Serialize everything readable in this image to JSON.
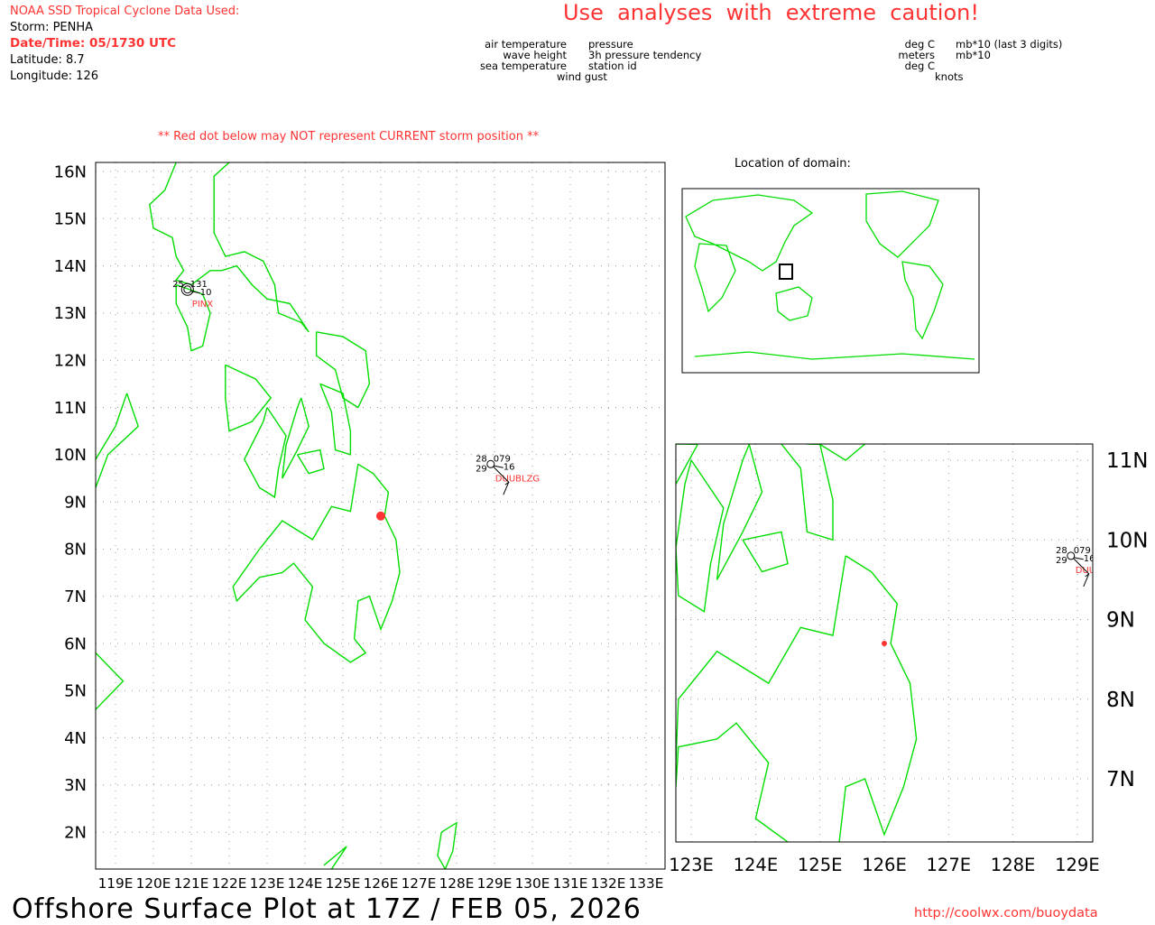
{
  "header": {
    "source": "NOAA SSD Tropical Cyclone Data Used:",
    "storm": "Storm: PENHA",
    "datetime": "Date/Time: 05/1730 UTC",
    "latitude": "Latitude: 8.7",
    "longitude": "Longitude: 126",
    "caution": "Use  analyses  with  extreme  caution!",
    "red_dot_note": "** Red dot below may NOT represent CURRENT storm position **"
  },
  "legend": {
    "left": {
      "air_temp": "air temperature",
      "wave": "wave height",
      "sea_temp": "sea temperature",
      "pressure": "pressure",
      "tendency": "3h pressure tendency",
      "station": "station id",
      "gust": "wind gust"
    },
    "right": {
      "air_temp": "deg C",
      "wave": "meters",
      "sea_temp": "deg C",
      "pressure": "mb*10 (last 3 digits)",
      "tendency": "mb*10",
      "gust": "knots"
    }
  },
  "main_map": {
    "lat_labels": [
      "16N",
      "15N",
      "14N",
      "13N",
      "12N",
      "11N",
      "10N",
      "9N",
      "8N",
      "7N",
      "6N",
      "5N",
      "4N",
      "3N",
      "2N"
    ],
    "lon_labels": [
      "119E",
      "120E",
      "121E",
      "122E",
      "123E",
      "124E",
      "125E",
      "126E",
      "127E",
      "128E",
      "129E",
      "130E",
      "131E",
      "132E",
      "133E"
    ]
  },
  "inset_map": {
    "lat_labels": [
      "11N",
      "10N",
      "9N",
      "8N",
      "7N"
    ],
    "lon_labels": [
      "123E",
      "124E",
      "125E",
      "126E",
      "127E",
      "128E",
      "129E"
    ]
  },
  "domain_map": {
    "title": "Location of domain:"
  },
  "stations": [
    {
      "id": "PINX",
      "air_temp": "25",
      "pressure": "131",
      "tendency": "10",
      "lat": 13.5,
      "lon": 120.9
    },
    {
      "id": "DUUBLZG",
      "air_temp": "28",
      "sea_temp": "29",
      "pressure": "079",
      "tendency": "16",
      "lat": 9.8,
      "lon": 128.9
    }
  ],
  "storm_position": {
    "lat": 8.7,
    "lon": 126,
    "color": "#ff3333"
  },
  "footer": {
    "title": "Offshore Surface Plot at 17Z / FEB 05, 2026",
    "url": "http://coolwx.com/buoydata"
  },
  "colors": {
    "coast": "#00dd00",
    "alert": "#ff3333",
    "grid": "#999999"
  }
}
